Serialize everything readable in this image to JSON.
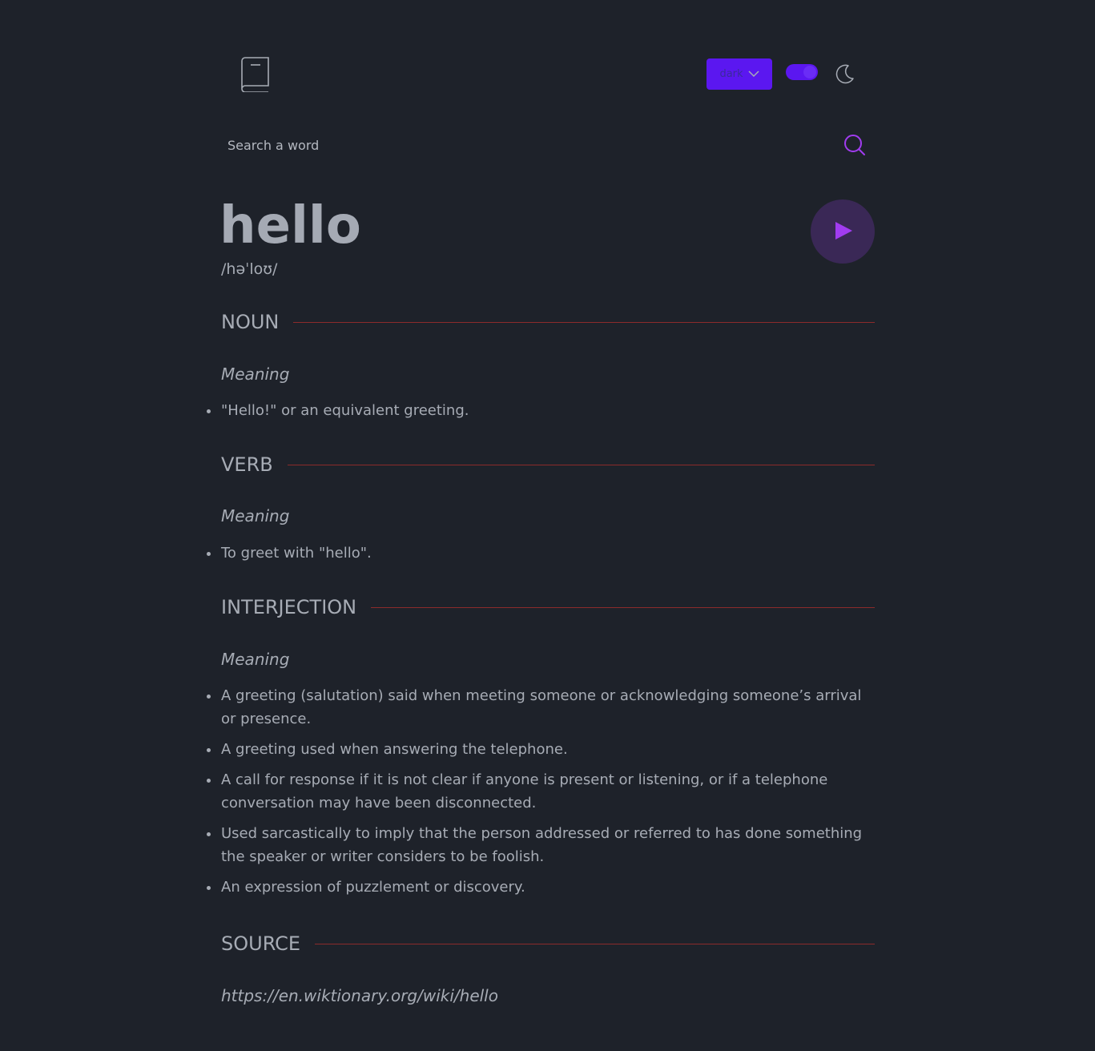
{
  "header": {
    "font_select_label": "dark",
    "theme_toggle_on": true,
    "accent_color": "#5b17f0"
  },
  "search": {
    "placeholder": "Search a word",
    "value": ""
  },
  "entry": {
    "word": "hello",
    "phonetic": "/həˈloʊ/"
  },
  "sections": [
    {
      "part_of_speech": "NOUN",
      "meaning_label": "Meaning",
      "definitions": [
        "\"Hello!\" or an equivalent greeting."
      ]
    },
    {
      "part_of_speech": "VERB",
      "meaning_label": "Meaning",
      "definitions": [
        "To greet with \"hello\"."
      ]
    },
    {
      "part_of_speech": "INTERJECTION",
      "meaning_label": "Meaning",
      "definitions": [
        "A greeting (salutation) said when meeting someone or acknowledging someone’s arrival or presence.",
        "A greeting used when answering the telephone.",
        "A call for response if it is not clear if anyone is present or listening, or if a telephone conversation may have been disconnected.",
        "Used sarcastically to imply that the person addressed or referred to has done something the speaker or writer considers to be foolish.",
        "An expression of puzzlement or discovery."
      ]
    }
  ],
  "source": {
    "heading": "SOURCE",
    "url": "https://en.wiktionary.org/wiki/hello"
  },
  "colors": {
    "background": "#1e222a",
    "text": "#a7acb5",
    "rule": "#8c2b2b",
    "play_button_bg": "#3a2856",
    "play_icon": "#a13cf0"
  }
}
